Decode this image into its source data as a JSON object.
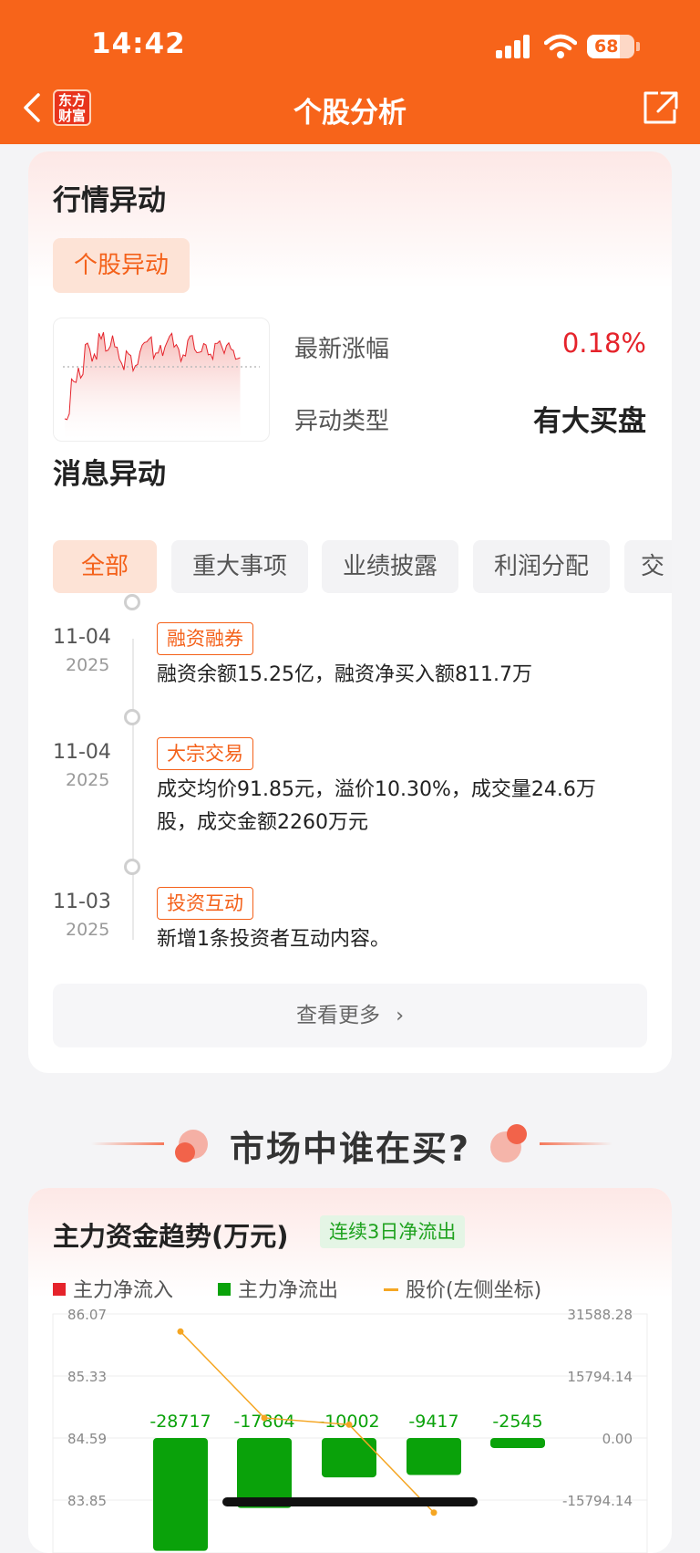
{
  "status_bar": {
    "time": "14:42",
    "battery": "68"
  },
  "nav": {
    "title": "个股分析",
    "logo_line1": "东方",
    "logo_line2": "财富"
  },
  "market_anomaly": {
    "title": "行情异动",
    "tab": "个股异动",
    "latest_change_label": "最新涨幅",
    "latest_change_value": "0.18%",
    "anomaly_type_label": "异动类型",
    "anomaly_type_value": "有大买盘"
  },
  "news_anomaly": {
    "title": "消息异动",
    "chips": [
      "全部",
      "重大事项",
      "业绩披露",
      "利润分配",
      "交"
    ],
    "items": [
      {
        "date": "11-04",
        "year": "2025",
        "tag": "融资融券",
        "text": "融资余额15.25亿，融资净买入额811.7万"
      },
      {
        "date": "11-04",
        "year": "2025",
        "tag": "大宗交易",
        "text": "成交均价91.85元，溢价10.30%，成交量24.6万股，成交金额2260万元"
      },
      {
        "date": "11-03",
        "year": "2025",
        "tag": "投资互动",
        "text": "新增1条投资者互动内容。"
      }
    ],
    "more_label": "查看更多"
  },
  "banner": {
    "title": "市场中谁在买?"
  },
  "fund_trend": {
    "title": "主力资金趋势(万元)",
    "badge": "连续3日净流出",
    "legend": [
      "主力净流入",
      "主力净流出",
      "股价(左侧坐标)"
    ],
    "colors": {
      "inflow": "#e5232b",
      "outflow": "#0aa20a",
      "price": "#f5a623"
    }
  },
  "chart_data": {
    "type": "bar",
    "title": "主力资金趋势(万元)",
    "left_axis_ticks": [
      "86.07",
      "85.33",
      "84.59",
      "83.85"
    ],
    "right_axis_ticks": [
      "31588.28",
      "15794.14",
      "0.00",
      "-15794.14"
    ],
    "left_ylim": [
      83.85,
      86.07
    ],
    "right_ylim": [
      -15794.14,
      31588.28
    ],
    "bar_values": [
      -28717,
      -17804,
      -10002,
      -9417,
      -2545
    ],
    "price_values": [
      85.86,
      84.83,
      84.75,
      83.7,
      null
    ]
  }
}
